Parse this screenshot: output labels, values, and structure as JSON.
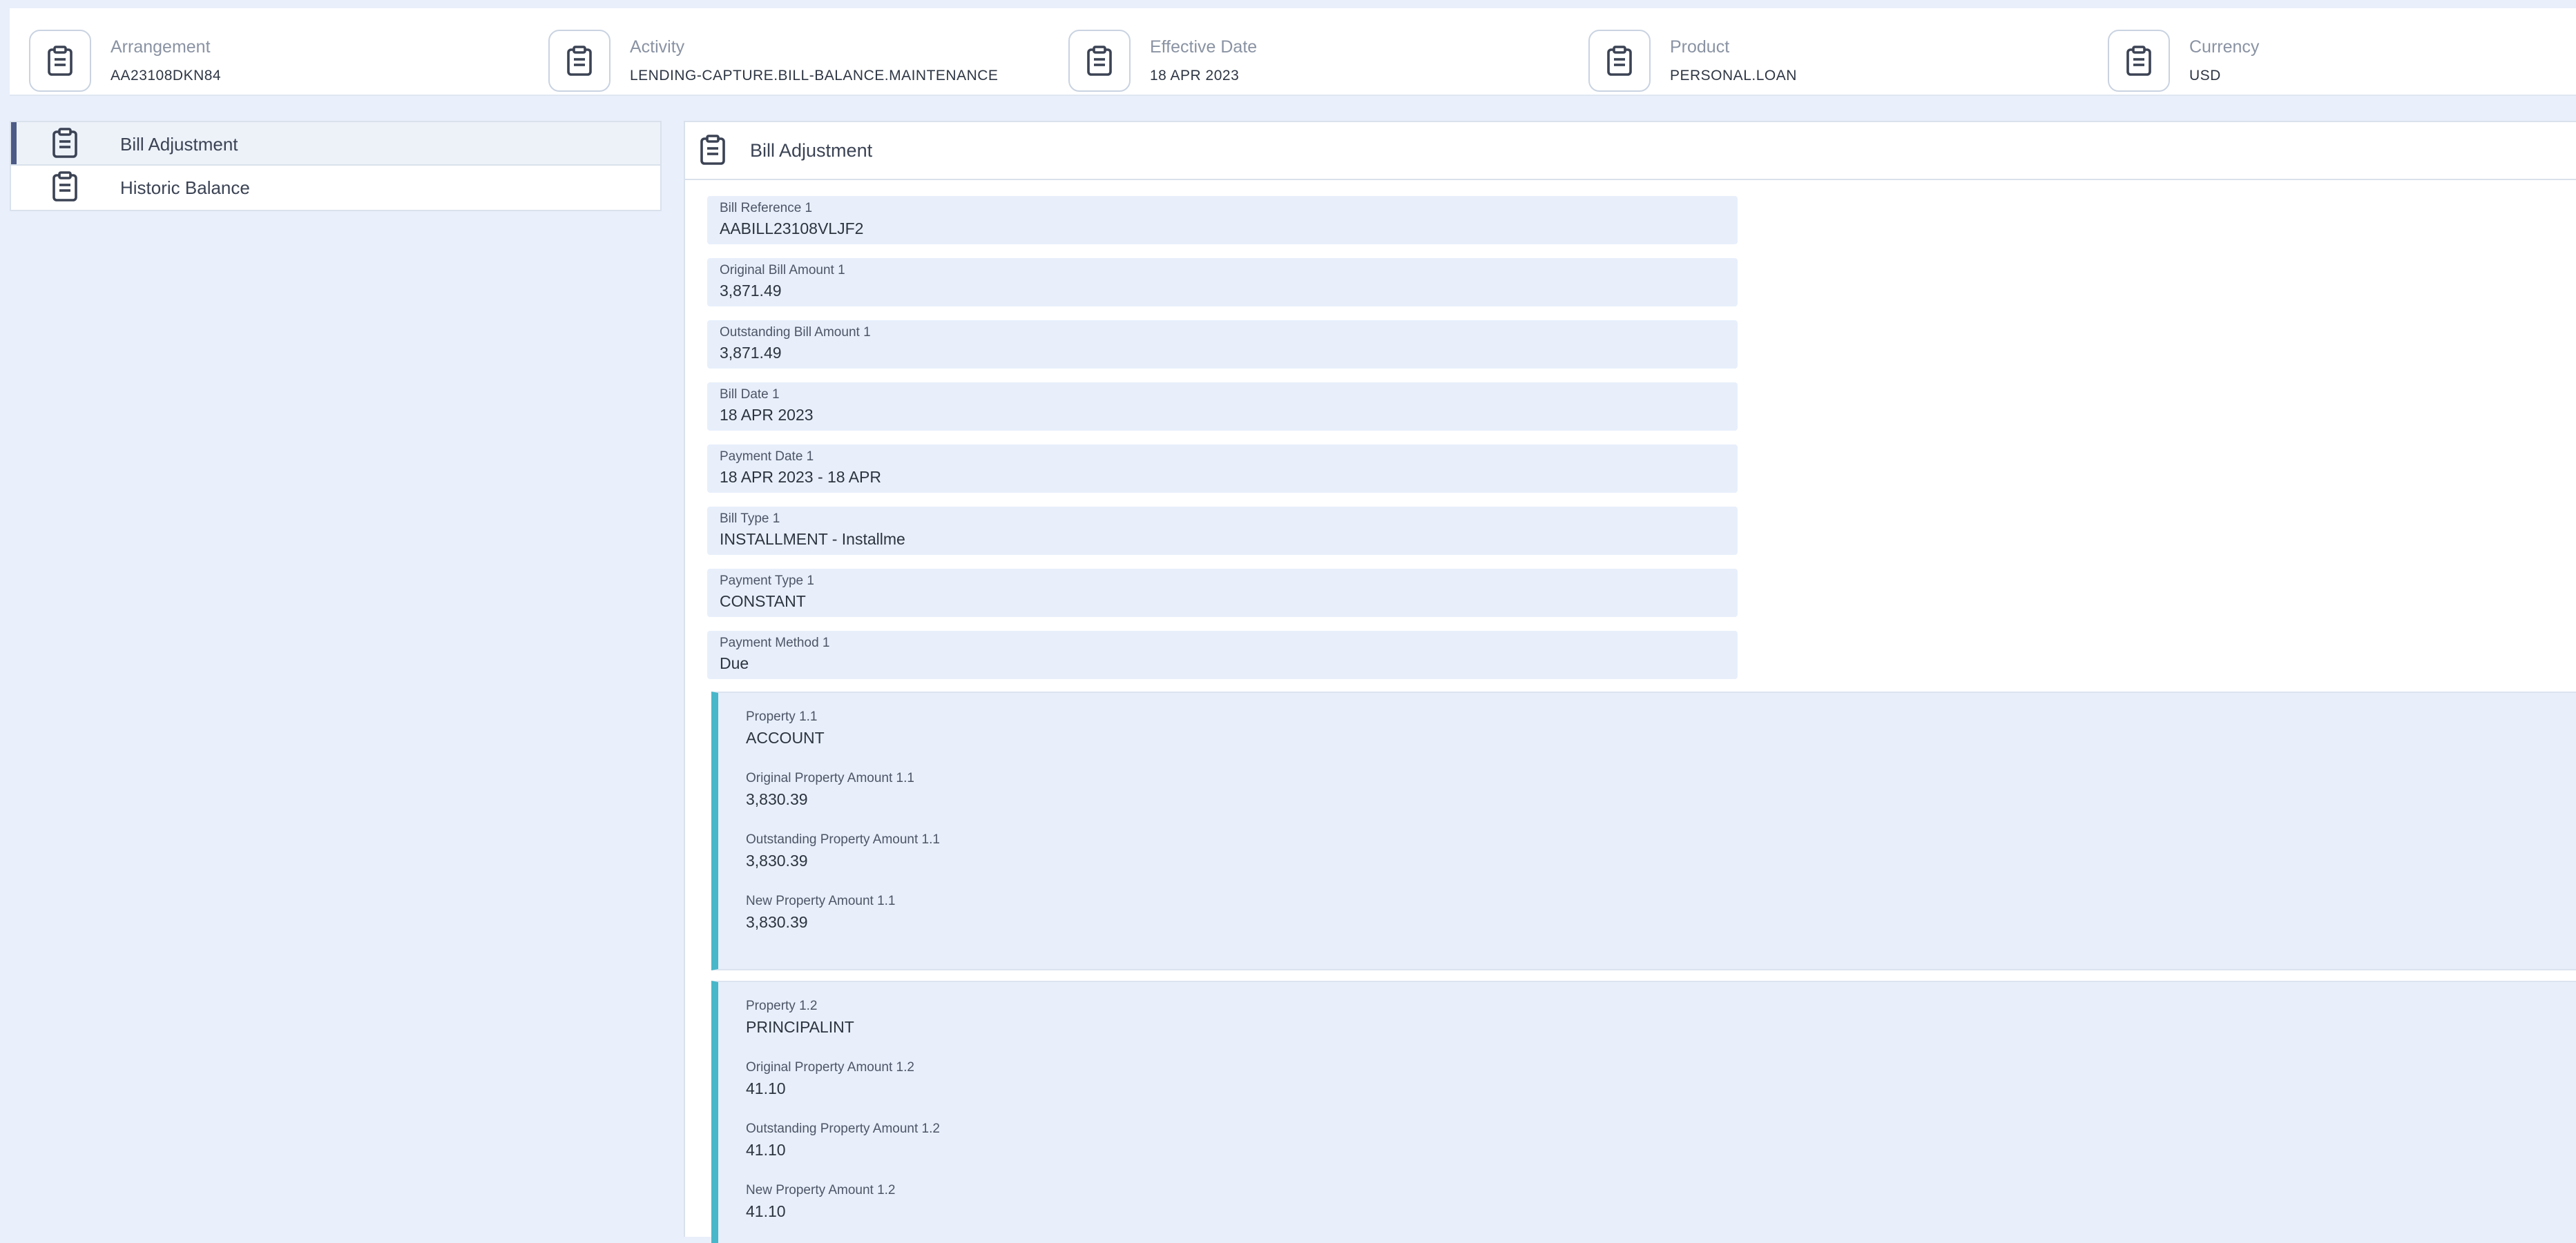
{
  "summary": [
    {
      "label": "Arrangement",
      "value": "AA23108DKN84",
      "icon": "clipboard-icon"
    },
    {
      "label": "Activity",
      "value": "LENDING-CAPTURE.BILL-BALANCE.MAINTENANCE",
      "icon": "clipboard-icon"
    },
    {
      "label": "Effective Date",
      "value": "18 APR 2023",
      "icon": "clipboard-icon"
    },
    {
      "label": "Product",
      "value": "PERSONAL.LOAN",
      "icon": "clipboard-icon"
    },
    {
      "label": "Currency",
      "value": "USD",
      "icon": "clipboard-icon"
    }
  ],
  "sidebar": {
    "items": [
      {
        "label": "Bill Adjustment",
        "active": true,
        "icon": "clipboard-icon"
      },
      {
        "label": "Historic Balance",
        "active": false,
        "icon": "clipboard-icon"
      }
    ]
  },
  "panel": {
    "title": "Bill Adjustment",
    "fields": [
      {
        "label": "Bill Reference 1",
        "value": "AABILL23108VLJF2"
      },
      {
        "label": "Original Bill Amount 1",
        "value": "3,871.49"
      },
      {
        "label": "Outstanding Bill Amount 1",
        "value": "3,871.49"
      },
      {
        "label": "Bill Date 1",
        "value": "18 APR 2023"
      },
      {
        "label": "Payment Date 1",
        "value": "18 APR 2023 - 18 APR"
      },
      {
        "label": "Bill Type 1",
        "value": "INSTALLMENT - Installme"
      },
      {
        "label": "Payment Type 1",
        "value": "CONSTANT"
      },
      {
        "label": "Payment Method 1",
        "value": "Due"
      }
    ],
    "properties": [
      {
        "rows": [
          {
            "label": "Property 1.1",
            "value": "ACCOUNT"
          },
          {
            "label": "Original Property Amount 1.1",
            "value": "3,830.39"
          },
          {
            "label": "Outstanding Property Amount 1.1",
            "value": "3,830.39"
          },
          {
            "label": "New Property Amount 1.1",
            "value": "3,830.39"
          }
        ]
      },
      {
        "rows": [
          {
            "label": "Property 1.2",
            "value": "PRINCIPALINT"
          },
          {
            "label": "Original Property Amount 1.2",
            "value": "41.10"
          },
          {
            "label": "Outstanding Property Amount 1.2",
            "value": "41.10"
          },
          {
            "label": "New Property Amount 1.2",
            "value": "41.10"
          }
        ]
      }
    ]
  },
  "colors": {
    "background": "#e9f0fb",
    "field_background": "#e8effb",
    "accent_bar": "#47b7c9",
    "active_indicator": "#4c5a86"
  }
}
